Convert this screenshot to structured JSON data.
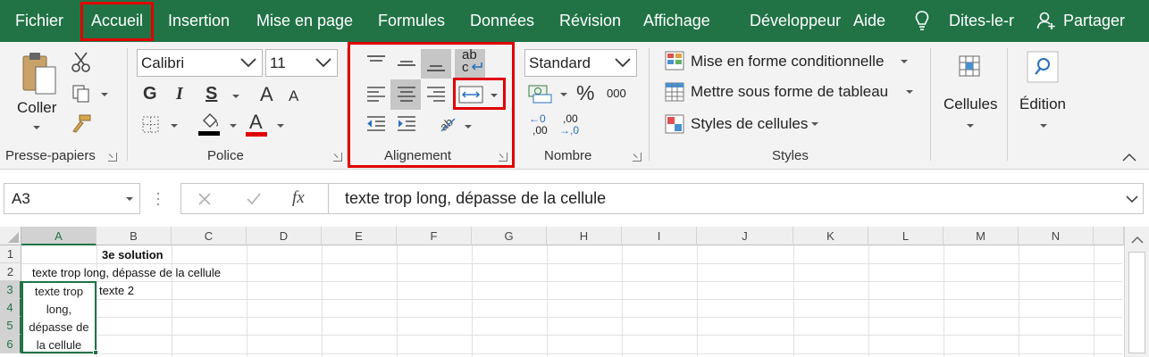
{
  "tabs": [
    "Fichier",
    "Accueil",
    "Insertion",
    "Mise en page",
    "Formules",
    "Données",
    "Révision",
    "Affichage",
    "Développeur",
    "Aide",
    "Dites-le-r",
    "Partager"
  ],
  "ribbon": {
    "clipboard": {
      "paste_label": "Coller",
      "group_label": "Presse-papiers"
    },
    "font": {
      "font_name": "Calibri",
      "font_size": "11",
      "bold": "G",
      "italic": "I",
      "underline": "S",
      "grow": "A",
      "shrink": "A",
      "font_color_letter": "A",
      "group_label": "Police"
    },
    "alignment": {
      "wrap_letters_top": "ab",
      "wrap_letters_bottom": "c",
      "group_label": "Alignement"
    },
    "number": {
      "format": "Standard",
      "percent": "%",
      "thousands": "000",
      "inc_decimal_top": "←0",
      "inc_decimal_bottom": ",00",
      "dec_decimal_top": ",00",
      "dec_decimal_bottom": "→,0",
      "group_label": "Nombre"
    },
    "styles": {
      "conditional": "Mise en forme conditionnelle",
      "table": "Mettre sous forme de tableau",
      "cell_styles": "Styles de cellules",
      "group_label": "Styles"
    },
    "cells": {
      "label": "Cellules"
    },
    "editing": {
      "label": "Édition"
    }
  },
  "formula_bar": {
    "name_box": "A3",
    "fx": "fx",
    "content": "texte trop long, dépasse de la cellule"
  },
  "grid": {
    "columns": [
      "A",
      "B",
      "C",
      "D",
      "E",
      "F",
      "G",
      "H",
      "I",
      "J",
      "K",
      "L",
      "M",
      "N"
    ],
    "rows": [
      "1",
      "2",
      "3",
      "4",
      "5",
      "6"
    ],
    "cells": {
      "B1": "3e solution",
      "A2": "texte trop long, dépasse de la cellule",
      "B3": "texte 2",
      "A3_lines": [
        "texte trop",
        "long,",
        "dépasse de",
        "la cellule"
      ]
    }
  },
  "colors": {
    "brand": "#217346",
    "highlight": "#e00000"
  }
}
